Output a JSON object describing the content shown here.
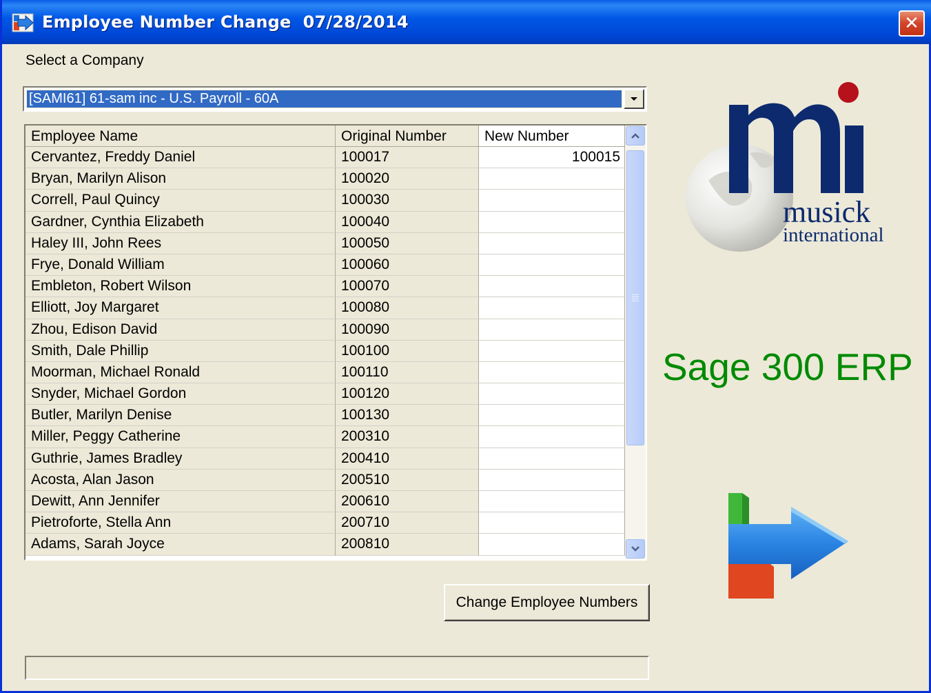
{
  "window": {
    "title": "Employee Number Change  07/28/2014",
    "close_label": "✕"
  },
  "company": {
    "label": "Select a Company",
    "selected": "[SAMI61] 61-sam inc - U.S. Payroll - 60A"
  },
  "grid": {
    "columns": [
      "Employee Name",
      "Original Number",
      "New Number"
    ],
    "rows": [
      {
        "name": "Cervantez, Freddy Daniel",
        "original": "100017",
        "new": "100015"
      },
      {
        "name": "Bryan, Marilyn Alison",
        "original": "100020",
        "new": ""
      },
      {
        "name": "Correll, Paul Quincy",
        "original": "100030",
        "new": ""
      },
      {
        "name": "Gardner, Cynthia Elizabeth",
        "original": "100040",
        "new": ""
      },
      {
        "name": "Haley III, John Rees",
        "original": "100050",
        "new": ""
      },
      {
        "name": "Frye, Donald William",
        "original": "100060",
        "new": ""
      },
      {
        "name": "Embleton, Robert Wilson",
        "original": "100070",
        "new": ""
      },
      {
        "name": "Elliott, Joy Margaret",
        "original": "100080",
        "new": ""
      },
      {
        "name": "Zhou, Edison David",
        "original": "100090",
        "new": ""
      },
      {
        "name": "Smith, Dale Phillip",
        "original": "100100",
        "new": ""
      },
      {
        "name": "Moorman, Michael Ronald",
        "original": "100110",
        "new": ""
      },
      {
        "name": "Snyder, Michael Gordon",
        "original": "100120",
        "new": ""
      },
      {
        "name": "Butler, Marilyn Denise",
        "original": "100130",
        "new": ""
      },
      {
        "name": "Miller, Peggy Catherine",
        "original": "200310",
        "new": ""
      },
      {
        "name": "Guthrie, James Bradley",
        "original": "200410",
        "new": ""
      },
      {
        "name": "Acosta, Alan Jason",
        "original": "200510",
        "new": ""
      },
      {
        "name": "Dewitt, Ann Jennifer",
        "original": "200610",
        "new": ""
      },
      {
        "name": "Pietroforte, Stella Ann",
        "original": "200710",
        "new": ""
      },
      {
        "name": "Adams, Sarah Joyce",
        "original": "200810",
        "new": ""
      }
    ]
  },
  "actions": {
    "change_label": "Change Employee Numbers"
  },
  "branding": {
    "logo_line1": "musick",
    "logo_line2": "international",
    "product": "Sage 300 ERP"
  },
  "colors": {
    "title_bar": "#0058e6",
    "selection": "#316ac5",
    "product_text": "#008a00",
    "logo_navy": "#0d2a6e",
    "logo_dot": "#b5121b"
  }
}
